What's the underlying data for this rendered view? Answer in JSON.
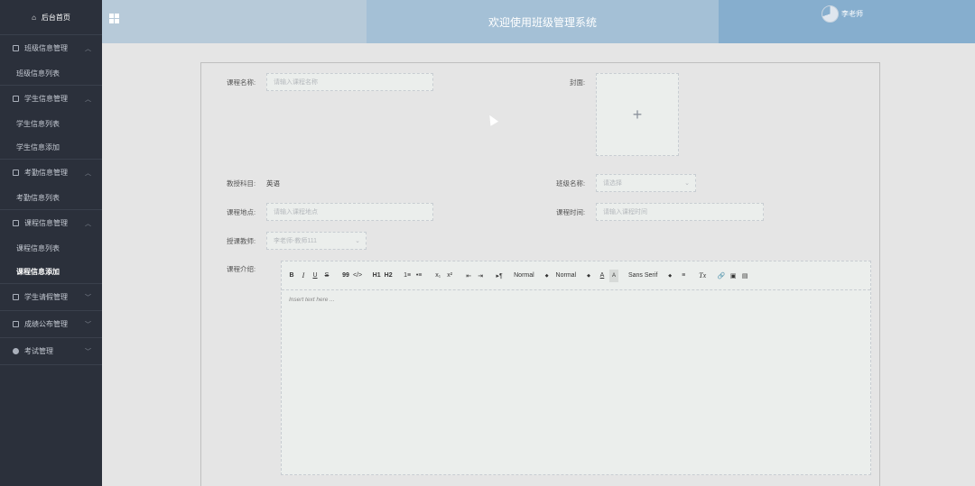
{
  "sidebar": {
    "home_label": "后台首页",
    "groups": [
      {
        "label": "班级信息管理",
        "items": [
          {
            "label": "班级信息列表"
          }
        ]
      },
      {
        "label": "学生信息管理",
        "items": [
          {
            "label": "学生信息列表"
          },
          {
            "label": "学生信息添加"
          }
        ]
      },
      {
        "label": "考勤信息管理",
        "items": [
          {
            "label": "考勤信息列表"
          }
        ]
      },
      {
        "label": "课程信息管理",
        "items": [
          {
            "label": "课程信息列表"
          },
          {
            "label": "课程信息添加"
          }
        ]
      },
      {
        "label": "学生请假管理",
        "items": []
      },
      {
        "label": "成绩公布管理",
        "items": []
      },
      {
        "label": "考试管理",
        "items": []
      }
    ]
  },
  "header": {
    "title": "欢迎使用班级管理系统",
    "user_name": "李老师"
  },
  "form": {
    "course_name_label": "课程名称:",
    "course_name_placeholder": "请输入课程名称",
    "cover_label": "封面:",
    "upload_plus": "+",
    "subject_label": "教授科目:",
    "subject_value": "英语",
    "class_label": "班级名称:",
    "class_placeholder": "请选择",
    "location_label": "课程地点:",
    "location_placeholder": "请输入课程地点",
    "time_label": "课程时间:",
    "time_placeholder": "请输入课程时间",
    "teacher_label": "授课教师:",
    "teacher_value": "李老师-教师111",
    "intro_label": "课程介绍:",
    "editor_placeholder": "Insert text here ..."
  },
  "toolbar": {
    "bold": "B",
    "italic": "I",
    "underline": "U",
    "strike": "S",
    "quote": "99",
    "code": "</>",
    "h1": "H1",
    "h2": "H2",
    "ordered": "1≡",
    "bullet": "•≡",
    "sub": "x₁",
    "sup": "x²",
    "outdent": "⇤",
    "indent": "⇥",
    "direction": "▸¶",
    "size_select": "Normal",
    "header_select": "Normal",
    "color": "A",
    "background": "A",
    "font_select": "Sans Serif",
    "align": "≡",
    "clean": "Tx",
    "link": "🔗",
    "image": "▣",
    "video": "▤"
  }
}
